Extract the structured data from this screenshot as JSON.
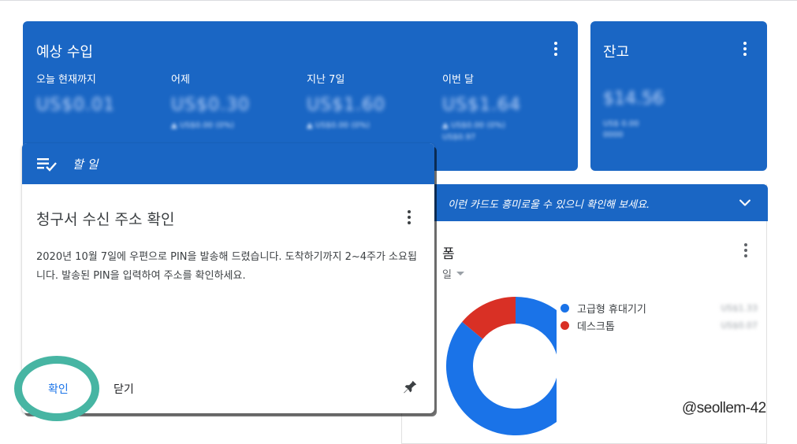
{
  "earnings": {
    "title": "예상 수입",
    "metrics": [
      {
        "label": "오늘 현재까지",
        "value": "US$0.01",
        "sub": "▲ US$0.00 (0%)",
        "sub2": ""
      },
      {
        "label": "어제",
        "value": "US$0.30",
        "sub": "▲ US$0.00 (0%)",
        "sub2": ""
      },
      {
        "label": "지난 7일",
        "value": "US$1.60",
        "sub": "▲ US$0.00 (0%)",
        "sub2": ""
      },
      {
        "label": "이번 달",
        "value": "US$1.64",
        "sub": "▲ US$0.00 (0%)",
        "sub2": "US$0.97"
      }
    ]
  },
  "balance": {
    "title": "잔고",
    "value": "$14.56",
    "sub1": "US$ 0.00",
    "sub2": "0000"
  },
  "suggestion": {
    "text": "이런 카드도 흥미로울 수 있으니 확인해 보세요."
  },
  "devices": {
    "title": "폼",
    "period": "일",
    "legend": [
      {
        "label": "고급형 휴대기기",
        "value": "US$1.33",
        "color": "#1a73e8"
      },
      {
        "label": "데스크톱",
        "value": "US$0.07",
        "color": "#d93025"
      }
    ]
  },
  "chart_data": {
    "type": "pie",
    "categories": [
      "고급형 휴대기기",
      "데스크톱"
    ],
    "values": [
      86,
      14
    ],
    "colors": [
      "#1a73e8",
      "#d93025"
    ]
  },
  "todo": {
    "header": "할 일",
    "title": "청구서 수신 주소 확인",
    "body": "2020년 10월 7일에 우편으로 PIN을 발송해 드렸습니다. 도착하기까지 2~4주가 소요됩니다. 발송된 PIN을 입력하여 주소를 확인하세요.",
    "confirm_label": "확인",
    "close_label": "닫기"
  },
  "watermark": "@seollem-42",
  "icons": {
    "more": "more-vert-icon",
    "expand": "chevron-down-icon",
    "todo": "checklist-icon",
    "pin": "pin-icon"
  }
}
